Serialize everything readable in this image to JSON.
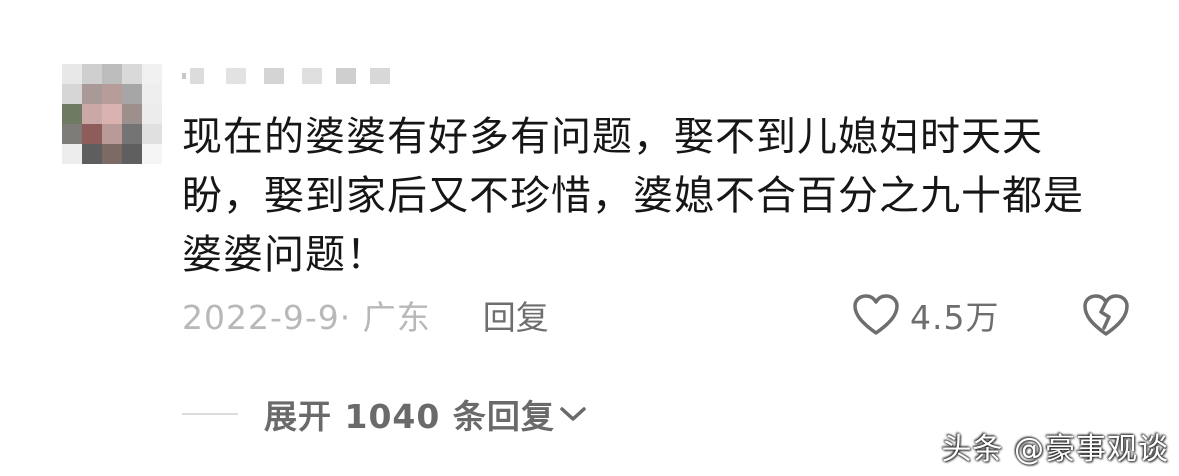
{
  "comment": {
    "author": "",
    "text": "现在的婆婆有好多有问题，娶不到儿媳妇时天天盼，娶到家后又不珍惜，婆媳不合百分之九十都是婆婆问题！",
    "date_location": "2022-9-9· 广东",
    "reply_label": "回复",
    "like_count": "4.5万",
    "expand_replies_label": "展开 1040 条回复"
  },
  "watermark": "头条 @豪事观谈",
  "colors": {
    "text_primary": "#161616",
    "text_secondary": "#6e6e6e",
    "text_muted": "#b8b8b8",
    "icon": "#6e6e6e"
  },
  "icons": {
    "like": "heart-outline-icon",
    "dislike": "broken-heart-icon",
    "expand": "chevron-down-icon"
  }
}
